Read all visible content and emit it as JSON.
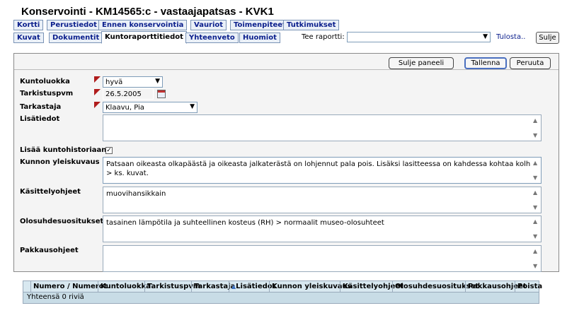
{
  "window": {
    "title": "Konservointi  - KM14565:c - vastaajapatsas - KVK1"
  },
  "tabs_row1": [
    "Kortti",
    "Perustiedot",
    "Ennen konservointia",
    "Vauriot",
    "Toimenpiteet",
    "Tutkimukset"
  ],
  "tabs_row2": [
    "Kuvat",
    "Dokumentit",
    "Kuntoraporttitiedot",
    "Yhteenveto",
    "Huomiot"
  ],
  "report": {
    "label": "Tee raportti:",
    "selected": "",
    "print_link": "Tulosta..",
    "close_button": "Sulje"
  },
  "panel_buttons": {
    "close_panel": "Sulje paneeli",
    "save": "Tallenna",
    "cancel": "Peruuta"
  },
  "form": {
    "condition_class": {
      "label": "Kuntoluokka",
      "value": "hyvä"
    },
    "inspection_date": {
      "label": "Tarkistuspvm",
      "value": "26.5.2005"
    },
    "inspector": {
      "label": "Tarkastaja",
      "value": "Klaavu, Pia"
    },
    "additional_info": {
      "label": "Lisätiedot",
      "value": ""
    },
    "add_history": {
      "label": "Lisää kuntohistoriaan",
      "checked": "✓"
    },
    "overview": {
      "label": "Kunnon yleiskuvaus",
      "value": "Patsaan oikeasta olkapäästä ja oikeasta jalkaterästä on lohjennut pala pois. Lisäksi lasitteessa on kahdessa kohtaa kolhu > ks. kuvat."
    },
    "handling": {
      "label": "Käsittelyohjeet",
      "value": "muovihansikkain"
    },
    "environment": {
      "label": "Olosuhdesuositukset",
      "value": "tasainen lämpötila ja suhteellinen kosteus (RH) > normaalit museo-olosuhteet"
    },
    "packing": {
      "label": "Pakkausohjeet",
      "value": ""
    }
  },
  "history_table": {
    "columns": [
      "Numero / Numerot",
      "Kuntoluokka",
      "Tarkistuspvm",
      "Tarkastaja",
      "Lisätiedot",
      "Kunnon yleiskuvaus",
      "Käsittelyohjeet",
      "Olosuhdesuositukset",
      "Pakkausohjeet",
      "Poista"
    ],
    "sort_indicator": "▲",
    "footer": "Yhteensä 0 riviä"
  }
}
